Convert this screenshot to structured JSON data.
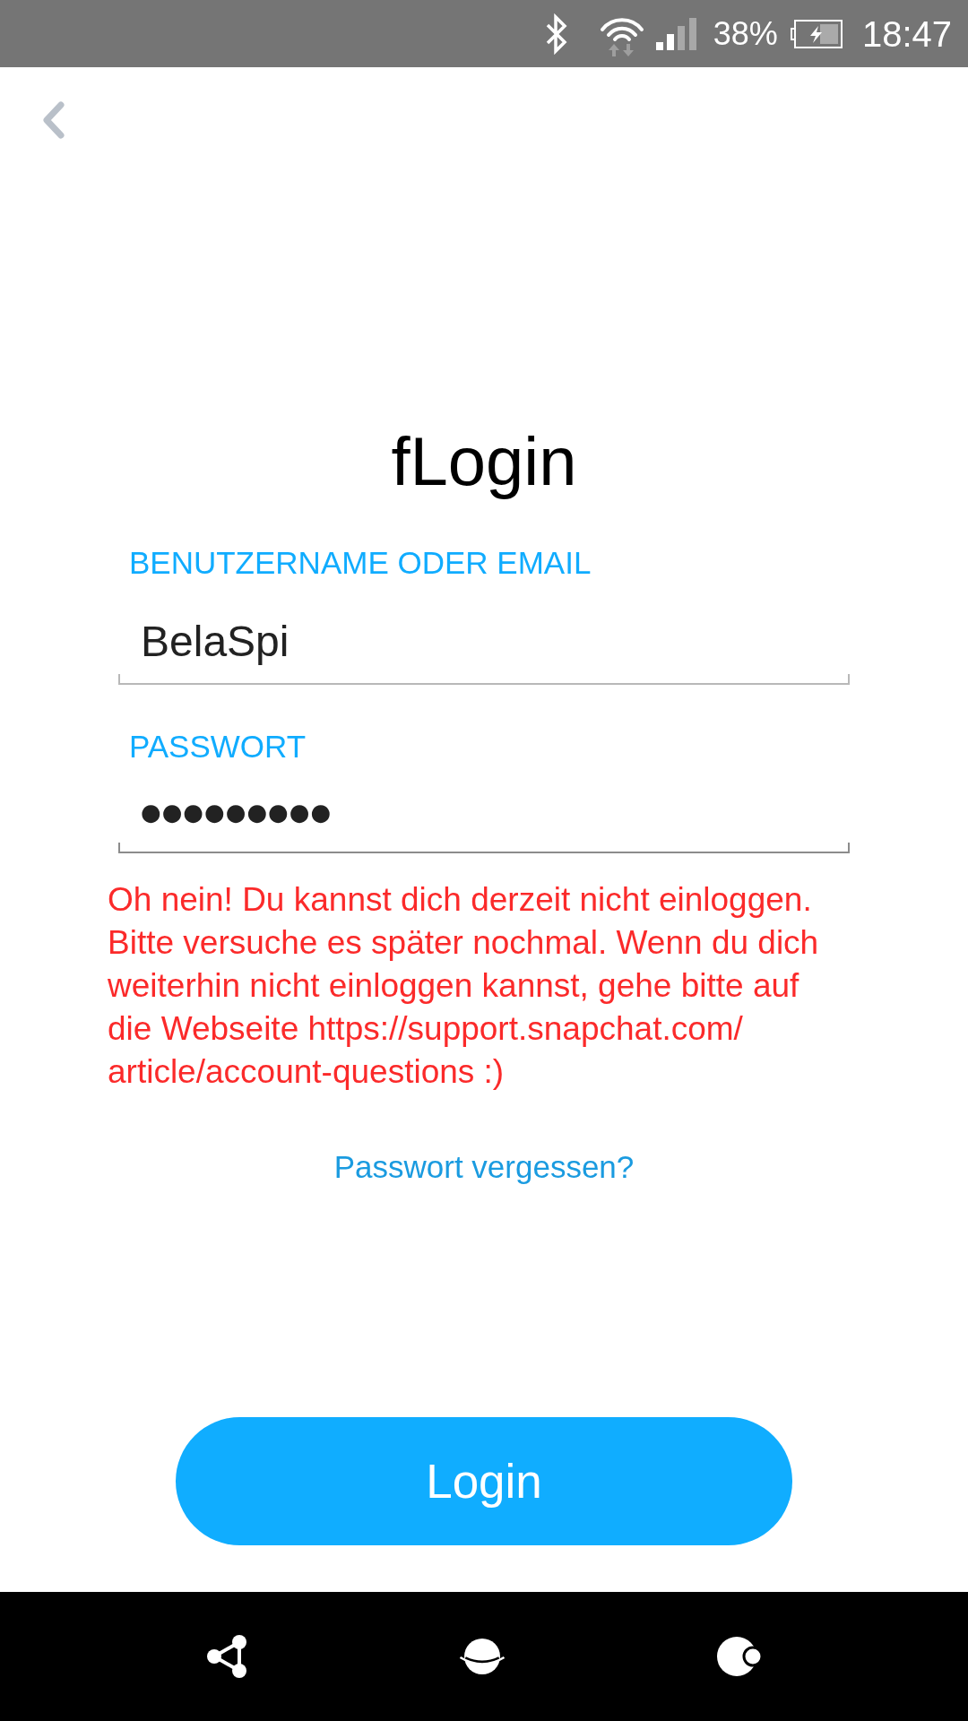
{
  "status_bar": {
    "battery": "38%",
    "time": "18:47"
  },
  "title": "fLogin",
  "fields": [
    {
      "kind": "text",
      "label": "BENUTZERNAME ODER EMAIL",
      "value": "BelaSpi",
      "focused": false
    },
    {
      "kind": "password",
      "label": "PASSWORT",
      "value": "●●●●●●●●●",
      "focused": true
    }
  ],
  "error": "Oh nein! Du kannst dich derzeit nicht einloggen. Bitte versuche es später nochmal. Wenn du dich weiterhin nicht einloggen kannst, gehe bitte auf die Webseite https://support.snapchat.com/article/account-questions :)",
  "forgot_password": "Passwort vergessen?",
  "login_button": "Login"
}
